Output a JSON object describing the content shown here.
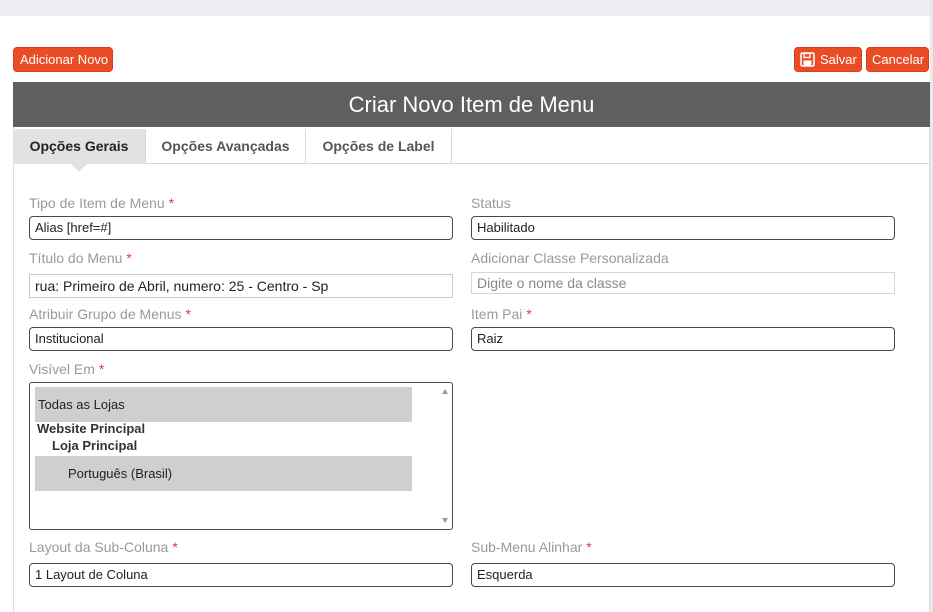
{
  "toolbar": {
    "add_label": "Adicionar Novo",
    "save_label": "Salvar",
    "cancel_label": "Cancelar"
  },
  "header": {
    "title": "Criar Novo Item de Menu"
  },
  "tabs": [
    {
      "label": "Opções Gerais",
      "active": true
    },
    {
      "label": "Opções Avançadas",
      "active": false
    },
    {
      "label": "Opções de Label",
      "active": false
    }
  ],
  "form": {
    "required_mark": "*",
    "menu_item_type": {
      "label": "Tipo de Item de Menu",
      "value": "Alias [href=#]"
    },
    "status": {
      "label": "Status",
      "value": "Habilitado"
    },
    "menu_title": {
      "label": "Título do Menu",
      "value": "rua: Primeiro de Abril, numero: 25 - Centro - Sp"
    },
    "custom_class": {
      "label": "Adicionar Classe Personalizada",
      "placeholder": "Digite o nome da classe"
    },
    "menu_group": {
      "label": "Atribuir Grupo de Menus",
      "value": "Institucional"
    },
    "parent_item": {
      "label": "Item Pai",
      "value": "Raiz"
    },
    "visible_in": {
      "label": "Visível Em",
      "options": {
        "all_stores": "Todas as Lojas",
        "website": "Website Principal",
        "store": "Loja Principal",
        "store_view": "Português (Brasil)"
      }
    },
    "subcolumn_layout": {
      "label": "Layout da Sub-Coluna",
      "value": "1 Layout de Coluna"
    },
    "submenu_align": {
      "label": "Sub-Menu Alinhar",
      "value": "Esquerda"
    }
  },
  "colors": {
    "accent": "#ea4d26",
    "header_bg": "#5f5f5f",
    "required": "#e53935"
  }
}
